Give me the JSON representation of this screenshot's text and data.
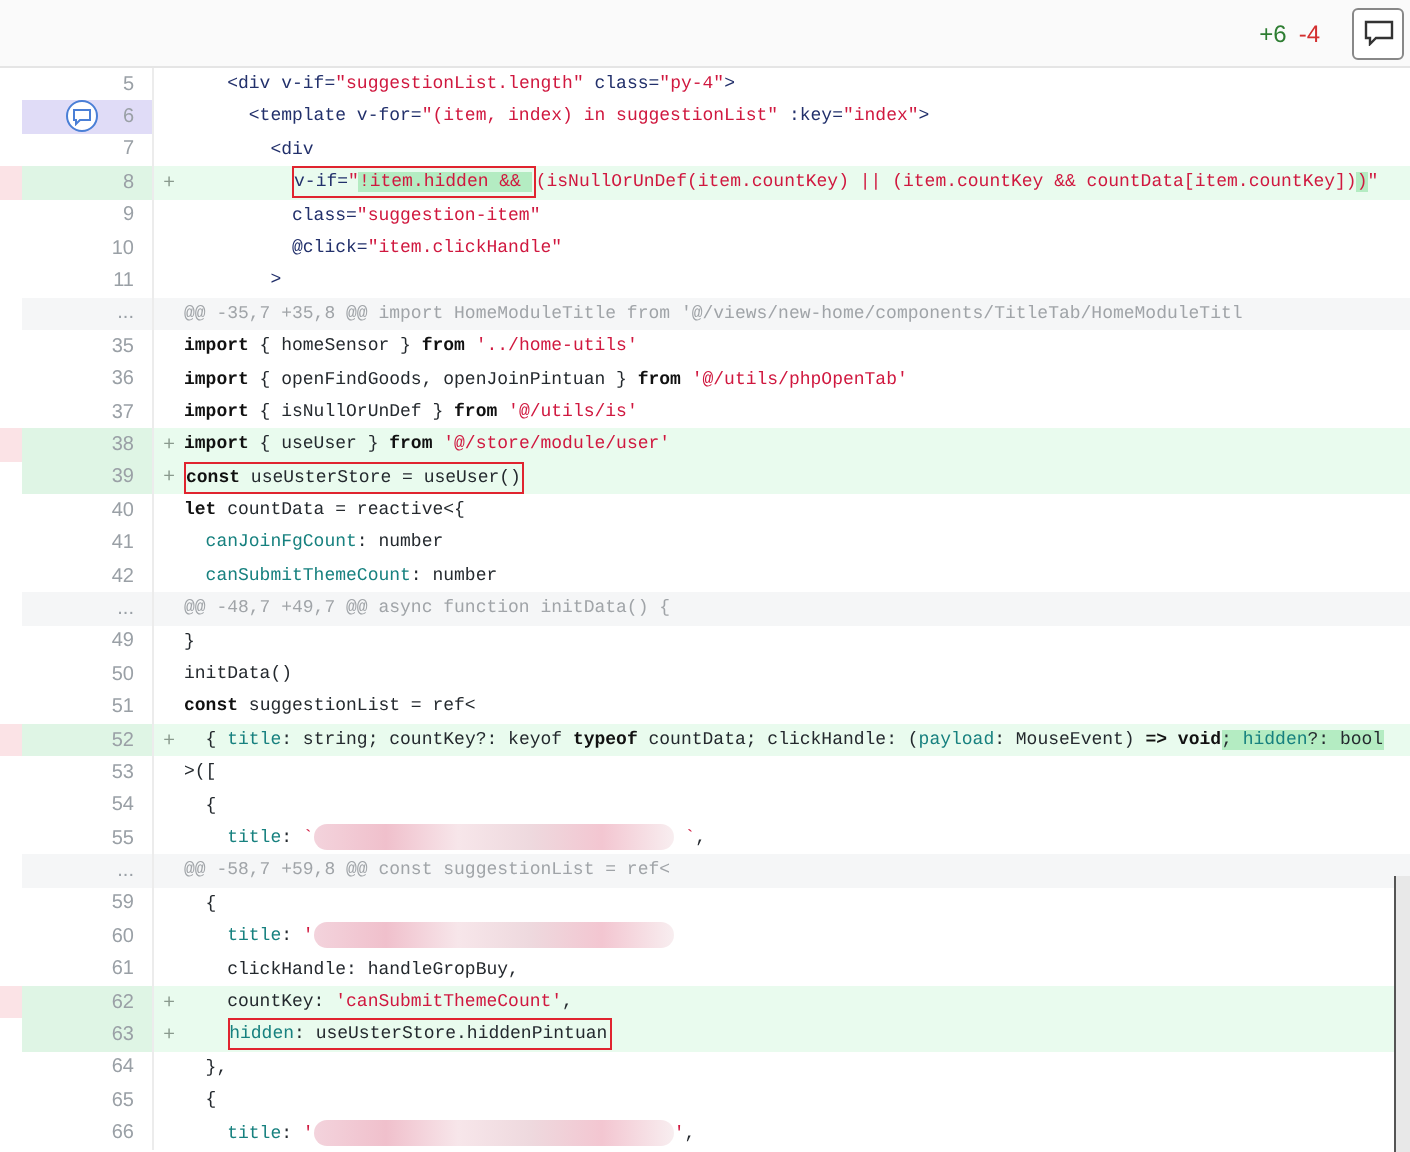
{
  "header": {
    "additions": "+6",
    "deletions": "-4"
  },
  "lines": [
    {
      "kind": "context",
      "number": "5",
      "marker": false,
      "comment": false,
      "segments": [
        {
          "t": "    <div v-if=",
          "kind": "tag"
        },
        {
          "t": "\"suggestionList.length\"",
          "kind": "str"
        },
        {
          "t": " class=",
          "kind": "tag"
        },
        {
          "t": "\"py-4\"",
          "kind": "str"
        },
        {
          "t": ">",
          "kind": "tag"
        }
      ]
    },
    {
      "kind": "context",
      "number": "6",
      "marker": false,
      "comment": true,
      "segments": [
        {
          "t": "      <template v-for=",
          "kind": "tag"
        },
        {
          "t": "\"(item, index) in suggestionList\"",
          "kind": "str"
        },
        {
          "t": " :key=",
          "kind": "tag"
        },
        {
          "t": "\"index\"",
          "kind": "str"
        },
        {
          "t": ">",
          "kind": "tag"
        }
      ]
    },
    {
      "kind": "context",
      "number": "7",
      "marker": false,
      "comment": false,
      "segments": [
        {
          "t": "        <div",
          "kind": "tag"
        }
      ]
    },
    {
      "kind": "added",
      "number": "8",
      "sign": "+",
      "marker": true,
      "comment": false,
      "segments": [
        {
          "t": "          v-if=",
          "kind": "tag",
          "boxed": true
        },
        {
          "t": "\"",
          "kind": "str",
          "boxed": true
        },
        {
          "t": "!item.hidden && ",
          "kind": "str",
          "boxed": true,
          "highlight": true
        },
        {
          "t": "(isNullOrUnDef(item.countKey) || (item.countKey && countData[item.countKey])",
          "kind": "str"
        },
        {
          "t": ")",
          "kind": "str",
          "highlight": true
        },
        {
          "t": "\"",
          "kind": "str"
        }
      ]
    },
    {
      "kind": "context",
      "number": "9",
      "marker": false,
      "comment": false,
      "segments": [
        {
          "t": "          class=",
          "kind": "tag"
        },
        {
          "t": "\"suggestion-item\"",
          "kind": "str"
        }
      ]
    },
    {
      "kind": "context",
      "number": "10",
      "marker": false,
      "comment": false,
      "segments": [
        {
          "t": "          @click=",
          "kind": "tag"
        },
        {
          "t": "\"item.clickHandle\"",
          "kind": "str"
        }
      ]
    },
    {
      "kind": "context",
      "number": "11",
      "marker": false,
      "comment": false,
      "segments": [
        {
          "t": "        >",
          "kind": "tag"
        }
      ]
    },
    {
      "kind": "hunk",
      "number": "...",
      "marker": false,
      "comment": false,
      "segments": [
        {
          "t": "@@ -35,7 +35,8 @@ import HomeModuleTitle from '@/views/new-home/components/TitleTab/HomeModuleTitl",
          "kind": "plain"
        }
      ]
    },
    {
      "kind": "context",
      "number": "35",
      "marker": false,
      "comment": false,
      "segments": [
        {
          "t": "import",
          "kind": "kw"
        },
        {
          "t": " { homeSensor } ",
          "kind": "plain"
        },
        {
          "t": "from",
          "kind": "kw"
        },
        {
          "t": " '../home-utils'",
          "kind": "str"
        }
      ]
    },
    {
      "kind": "context",
      "number": "36",
      "marker": false,
      "comment": false,
      "segments": [
        {
          "t": "import",
          "kind": "kw"
        },
        {
          "t": " { openFindGoods, openJoinPintuan } ",
          "kind": "plain"
        },
        {
          "t": "from",
          "kind": "kw"
        },
        {
          "t": " '@/utils/phpOpenTab'",
          "kind": "str"
        }
      ]
    },
    {
      "kind": "context",
      "number": "37",
      "marker": false,
      "comment": false,
      "segments": [
        {
          "t": "import",
          "kind": "kw"
        },
        {
          "t": " { isNullOrUnDef } ",
          "kind": "plain"
        },
        {
          "t": "from",
          "kind": "kw"
        },
        {
          "t": " '@/utils/is'",
          "kind": "str"
        }
      ]
    },
    {
      "kind": "added",
      "number": "38",
      "sign": "+",
      "marker": true,
      "comment": false,
      "segments": [
        {
          "t": "import",
          "kind": "kw"
        },
        {
          "t": " { useUser } ",
          "kind": "plain"
        },
        {
          "t": "from",
          "kind": "kw"
        },
        {
          "t": " '@/store/module/user'",
          "kind": "str"
        }
      ]
    },
    {
      "kind": "added",
      "number": "39",
      "sign": "+",
      "marker": false,
      "comment": false,
      "segments": [
        {
          "t": "const",
          "kind": "kw",
          "boxed": true
        },
        {
          "t": " useUsterStore = useUser()",
          "kind": "plain",
          "boxed": true
        }
      ]
    },
    {
      "kind": "context",
      "number": "40",
      "marker": false,
      "comment": false,
      "segments": [
        {
          "t": "let",
          "kind": "kw"
        },
        {
          "t": " countData = reactive<{",
          "kind": "plain"
        }
      ]
    },
    {
      "kind": "context",
      "number": "41",
      "marker": false,
      "comment": false,
      "segments": [
        {
          "t": "  canJoinFgCount",
          "kind": "prop"
        },
        {
          "t": ": number",
          "kind": "plain"
        }
      ]
    },
    {
      "kind": "context",
      "number": "42",
      "marker": false,
      "comment": false,
      "segments": [
        {
          "t": "  canSubmitThemeCount",
          "kind": "prop"
        },
        {
          "t": ": number",
          "kind": "plain"
        }
      ]
    },
    {
      "kind": "hunk",
      "number": "...",
      "marker": false,
      "comment": false,
      "segments": [
        {
          "t": "@@ -48,7 +49,7 @@ async function initData() {",
          "kind": "plain"
        }
      ]
    },
    {
      "kind": "context",
      "number": "49",
      "marker": false,
      "comment": false,
      "segments": [
        {
          "t": "}",
          "kind": "plain"
        }
      ]
    },
    {
      "kind": "context",
      "number": "50",
      "marker": false,
      "comment": false,
      "segments": [
        {
          "t": "initData()",
          "kind": "plain"
        }
      ]
    },
    {
      "kind": "context",
      "number": "51",
      "marker": false,
      "comment": false,
      "segments": [
        {
          "t": "const",
          "kind": "kw"
        },
        {
          "t": " suggestionList = ref<",
          "kind": "plain"
        }
      ]
    },
    {
      "kind": "added",
      "number": "52",
      "sign": "+",
      "marker": true,
      "comment": false,
      "segments": [
        {
          "t": "  { ",
          "kind": "plain"
        },
        {
          "t": "title",
          "kind": "prop"
        },
        {
          "t": ": string; countKey?: keyof ",
          "kind": "plain"
        },
        {
          "t": "typeof",
          "kind": "kw"
        },
        {
          "t": " countData; clickHandle: (",
          "kind": "plain"
        },
        {
          "t": "payload",
          "kind": "prop"
        },
        {
          "t": ": MouseEvent) ",
          "kind": "plain"
        },
        {
          "t": "=> void",
          "kind": "kw"
        },
        {
          "t": "; ",
          "kind": "plain",
          "highlight": true
        },
        {
          "t": "hidden",
          "kind": "prop",
          "highlight": true
        },
        {
          "t": "?: bool",
          "kind": "plain",
          "highlight": true
        }
      ]
    },
    {
      "kind": "context",
      "number": "53",
      "marker": false,
      "comment": false,
      "segments": [
        {
          "t": ">([",
          "kind": "plain"
        }
      ]
    },
    {
      "kind": "context",
      "number": "54",
      "marker": false,
      "comment": false,
      "segments": [
        {
          "t": "  {",
          "kind": "plain"
        }
      ]
    },
    {
      "kind": "context",
      "number": "55",
      "marker": false,
      "comment": false,
      "segments": [
        {
          "t": "    title",
          "kind": "prop"
        },
        {
          "t": ": ",
          "kind": "plain"
        },
        {
          "t": "`",
          "kind": "str"
        },
        {
          "kind": "redacted"
        },
        {
          "t": " `",
          "kind": "str"
        },
        {
          "t": ",",
          "kind": "plain"
        }
      ]
    },
    {
      "kind": "hunk",
      "number": "...",
      "marker": false,
      "comment": false,
      "segments": [
        {
          "t": "@@ -58,7 +59,8 @@ const suggestionList = ref<",
          "kind": "plain"
        }
      ]
    },
    {
      "kind": "context",
      "number": "59",
      "marker": false,
      "comment": false,
      "segments": [
        {
          "t": "  {",
          "kind": "plain"
        }
      ]
    },
    {
      "kind": "context",
      "number": "60",
      "marker": false,
      "comment": false,
      "segments": [
        {
          "t": "    title",
          "kind": "prop"
        },
        {
          "t": ": ",
          "kind": "plain"
        },
        {
          "t": "'",
          "kind": "str"
        },
        {
          "kind": "redacted"
        }
      ]
    },
    {
      "kind": "context",
      "number": "61",
      "marker": false,
      "comment": false,
      "segments": [
        {
          "t": "    clickHandle: handleGropBuy,",
          "kind": "plain"
        }
      ]
    },
    {
      "kind": "added",
      "number": "62",
      "sign": "+",
      "marker": true,
      "comment": false,
      "segments": [
        {
          "t": "    countKey: ",
          "kind": "plain"
        },
        {
          "t": "'canSubmitThemeCount'",
          "kind": "str"
        },
        {
          "t": ",",
          "kind": "plain"
        }
      ]
    },
    {
      "kind": "added",
      "number": "63",
      "sign": "+",
      "marker": false,
      "comment": false,
      "segments": [
        {
          "t": "    hidden",
          "kind": "prop",
          "boxed": true
        },
        {
          "t": ": useUsterStore.hiddenPintuan",
          "kind": "plain",
          "boxed": true
        }
      ]
    },
    {
      "kind": "context",
      "number": "64",
      "marker": false,
      "comment": false,
      "segments": [
        {
          "t": "  },",
          "kind": "plain"
        }
      ]
    },
    {
      "kind": "context",
      "number": "65",
      "marker": false,
      "comment": false,
      "segments": [
        {
          "t": "  {",
          "kind": "plain"
        }
      ]
    },
    {
      "kind": "context",
      "number": "66",
      "marker": false,
      "comment": false,
      "segments": [
        {
          "t": "    title",
          "kind": "prop"
        },
        {
          "t": ": ",
          "kind": "plain"
        },
        {
          "t": "'",
          "kind": "str"
        },
        {
          "kind": "redacted"
        },
        {
          "t": "'",
          "kind": "str"
        },
        {
          "t": ",",
          "kind": "plain"
        }
      ]
    }
  ]
}
